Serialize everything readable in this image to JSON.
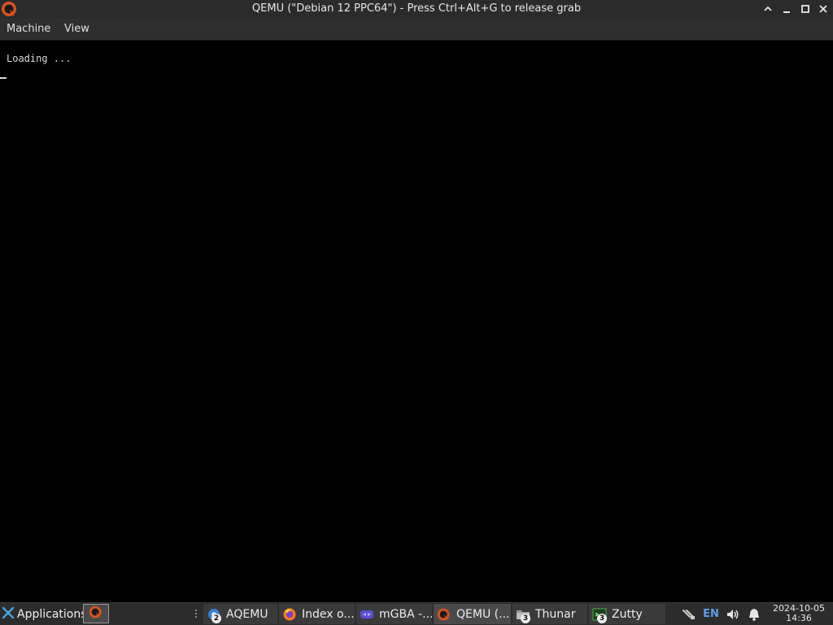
{
  "window": {
    "title": "QEMU (\"Debian 12 PPC64\") - Press Ctrl+Alt+G to release grab",
    "icon": "qemu-icon",
    "controls": [
      "maximize-up-icon",
      "minimize-icon",
      "maximize-icon",
      "close-icon"
    ]
  },
  "menubar": {
    "items": [
      {
        "label": "Machine"
      },
      {
        "label": "View"
      }
    ]
  },
  "guest": {
    "console_text": "Loading ...",
    "cursor": "_"
  },
  "taskbar": {
    "applications_label": "Applications",
    "tasks": [
      {
        "label": "AQEMU",
        "icon": "aqemu-icon",
        "badge": "2"
      },
      {
        "label": "Index o...",
        "icon": "firefox-icon",
        "badge": ""
      },
      {
        "label": "mGBA -...",
        "icon": "mgba-icon",
        "badge": ""
      },
      {
        "label": "QEMU (...",
        "icon": "qemu-icon",
        "badge": ""
      },
      {
        "label": "Thunar",
        "icon": "folder-icon",
        "badge": "3"
      },
      {
        "label": "Zutty",
        "icon": "terminal-icon",
        "badge": "3"
      }
    ],
    "tray": {
      "language": "EN",
      "date": "2024-10-05",
      "time": "14:36"
    }
  },
  "colors": {
    "background": "#000000",
    "titlebar": "#2b2b2b",
    "taskbar": "#2c2c2c",
    "lang_accent": "#5aa0e6"
  }
}
